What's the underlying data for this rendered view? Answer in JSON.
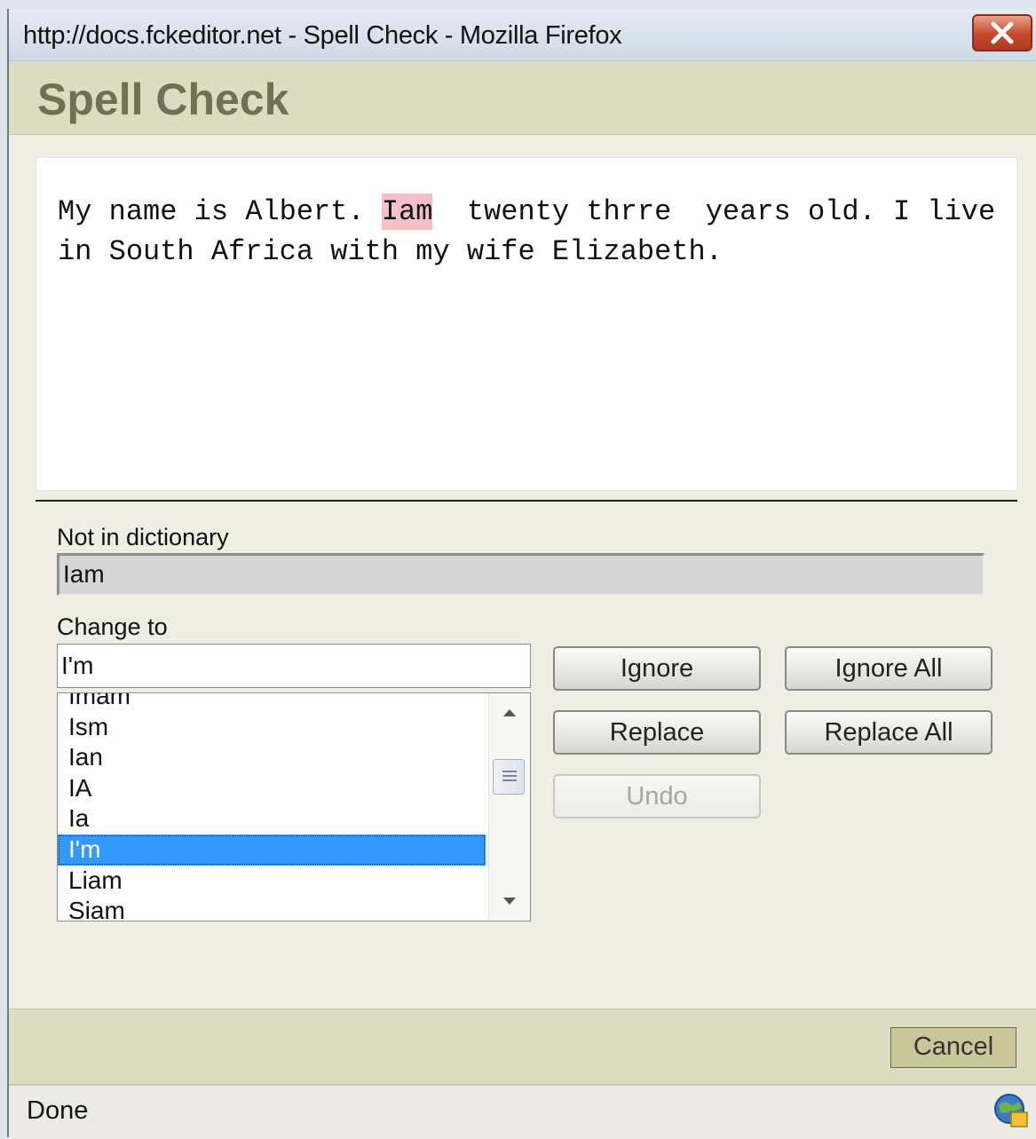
{
  "window": {
    "title": "http://docs.fckeditor.net - Spell Check - Mozilla Firefox"
  },
  "header": {
    "title": "Spell Check"
  },
  "document": {
    "before": "My name is Albert. ",
    "misspelled": "Iam",
    "after": "  twenty thrre  years old. I live in South Africa with my wife Elizabeth."
  },
  "not_in_dictionary": {
    "label": "Not in dictionary",
    "value": "Iam"
  },
  "change_to": {
    "label": "Change to",
    "value": "I'm"
  },
  "suggestions": {
    "items": [
      "Imam",
      "Ism",
      "Ian",
      "IA",
      "Ia",
      "I'm",
      "Liam",
      "Siam"
    ],
    "selected": "I'm"
  },
  "buttons": {
    "ignore": "Ignore",
    "ignore_all": "Ignore All",
    "replace": "Replace",
    "replace_all": "Replace All",
    "undo": "Undo",
    "cancel": "Cancel"
  },
  "status": {
    "text": "Done"
  },
  "colors": {
    "highlight": "#f4c0c8",
    "header_bg": "#dcdcc2",
    "selected_item": "#3399ff"
  },
  "icons": {
    "close": "close-icon",
    "scroll_up": "arrow-up-icon",
    "scroll_down": "arrow-down-icon",
    "status": "globe-icon"
  }
}
